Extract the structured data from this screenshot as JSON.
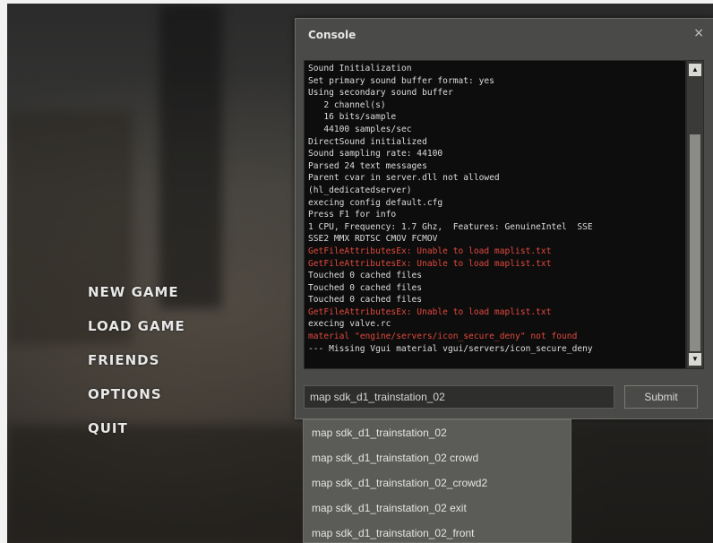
{
  "menu": {
    "items": [
      "NEW GAME",
      "LOAD GAME",
      "FRIENDS",
      "OPTIONS",
      "QUIT"
    ]
  },
  "console": {
    "title": "Console",
    "close_glyph": "×",
    "log": [
      {
        "text": "Sound Initialization",
        "error": false
      },
      {
        "text": "Set primary sound buffer format: yes",
        "error": false
      },
      {
        "text": "Using secondary sound buffer",
        "error": false
      },
      {
        "text": "   2 channel(s)",
        "error": false
      },
      {
        "text": "   16 bits/sample",
        "error": false
      },
      {
        "text": "   44100 samples/sec",
        "error": false
      },
      {
        "text": "DirectSound initialized",
        "error": false
      },
      {
        "text": "Sound sampling rate: 44100",
        "error": false
      },
      {
        "text": "Parsed 24 text messages",
        "error": false
      },
      {
        "text": "Parent cvar in server.dll not allowed",
        "error": false
      },
      {
        "text": "(hl_dedicatedserver)",
        "error": false
      },
      {
        "text": "execing config default.cfg",
        "error": false
      },
      {
        "text": "Press F1 for info",
        "error": false
      },
      {
        "text": "1 CPU, Frequency: 1.7 Ghz,  Features: GenuineIntel  SSE",
        "error": false
      },
      {
        "text": "SSE2 MMX RDTSC CMOV FCMOV",
        "error": false
      },
      {
        "text": "GetFileAttributesEx: Unable to load maplist.txt",
        "error": true
      },
      {
        "text": "GetFileAttributesEx: Unable to load maplist.txt",
        "error": true
      },
      {
        "text": "Touched 0 cached files",
        "error": false
      },
      {
        "text": "Touched 0 cached files",
        "error": false
      },
      {
        "text": "Touched 0 cached files",
        "error": false
      },
      {
        "text": "GetFileAttributesEx: Unable to load maplist.txt",
        "error": true
      },
      {
        "text": "execing valve.rc",
        "error": false
      },
      {
        "text": "material \"engine/servers/icon_secure_deny\" not found",
        "error": true
      },
      {
        "text": "--- Missing Vgui material vgui/servers/icon_secure_deny",
        "error": false
      }
    ],
    "scroll_up": "▲",
    "scroll_down": "▼",
    "input_value": "map sdk_d1_trainstation_02",
    "submit_label": "Submit",
    "suggestions": [
      "map sdk_d1_trainstation_02",
      "map sdk_d1_trainstation_02 crowd",
      "map sdk_d1_trainstation_02_crowd2",
      "map sdk_d1_trainstation_02 exit",
      "map sdk_d1_trainstation_02_front"
    ]
  }
}
